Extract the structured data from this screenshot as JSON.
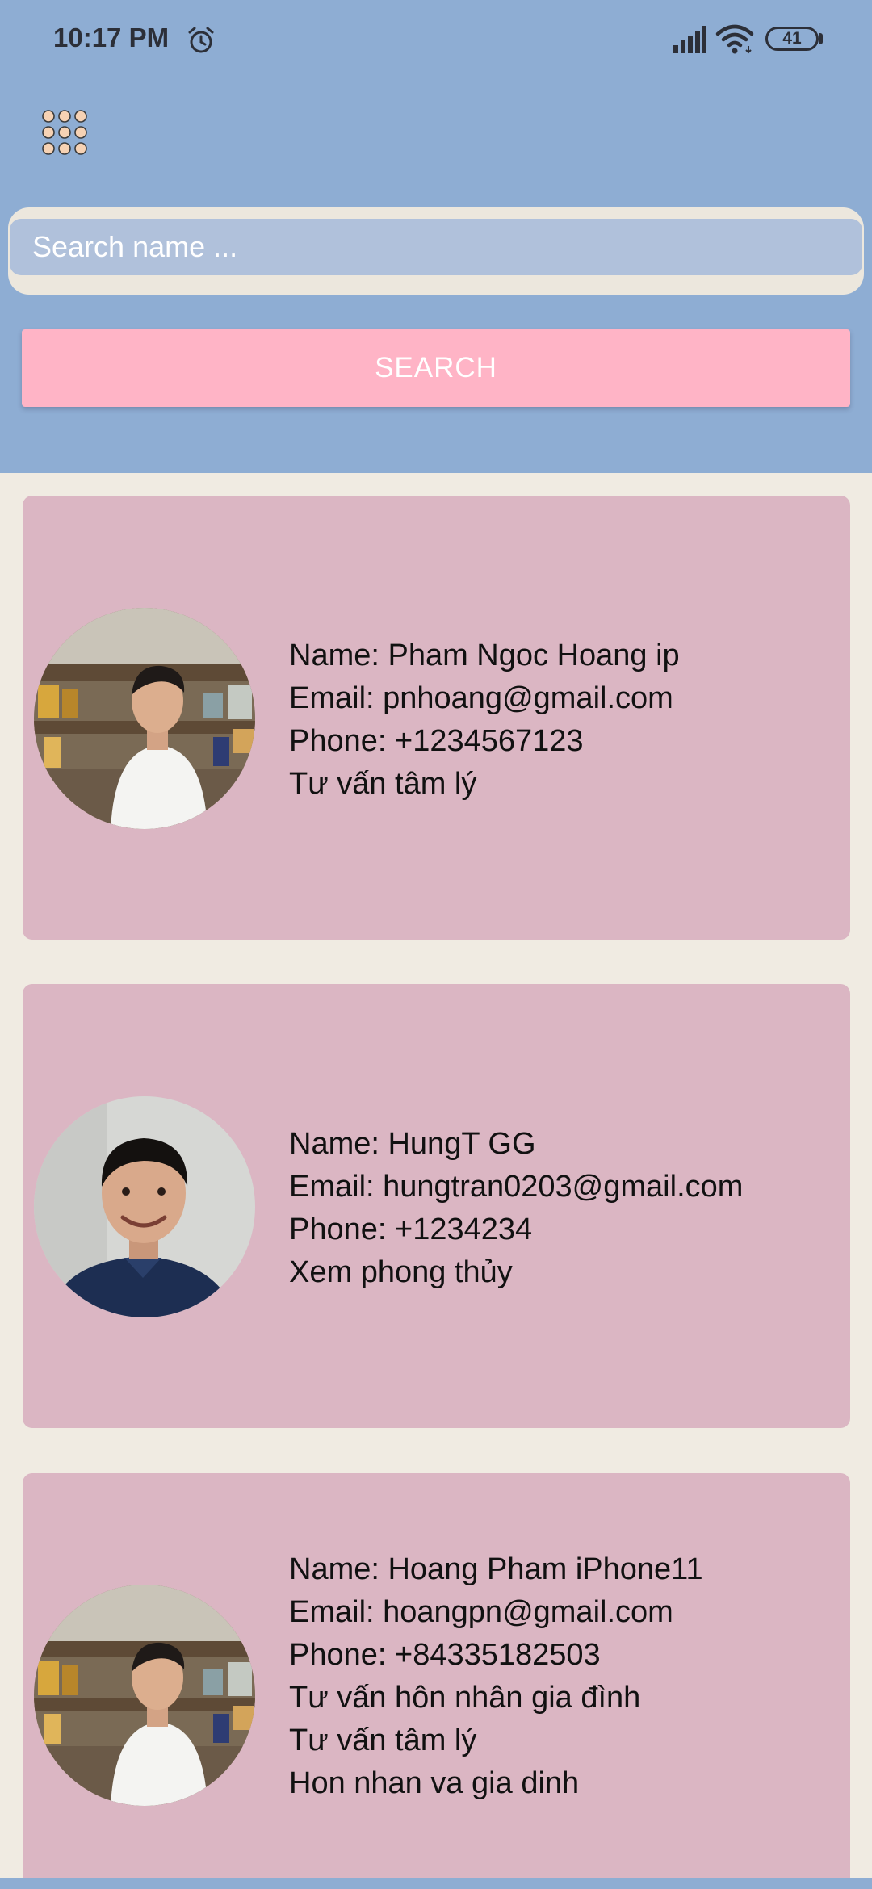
{
  "status_bar": {
    "time": "10:17 PM",
    "battery": "41",
    "icons": [
      "alarm-icon",
      "signal-icon",
      "wifi-icon",
      "battery-icon"
    ]
  },
  "toolbar": {
    "menu_icon": "apps-grid-icon"
  },
  "search": {
    "placeholder": "Search name ...",
    "value": "",
    "button_label": "SEARCH"
  },
  "contacts": [
    {
      "name": "Name: Pham Ngoc Hoang ip",
      "email": "Email: pnhoang@gmail.com",
      "phone": "Phone: +1234567123",
      "services": [
        "Tư vấn tâm lý"
      ]
    },
    {
      "name": "Name: HungT GG",
      "email": "Email: hungtran0203@gmail.com",
      "phone": "Phone: +1234234",
      "services": [
        "Xem phong thủy"
      ]
    },
    {
      "name": "Name: Hoang Pham iPhone11",
      "email": "Email: hoangpn@gmail.com",
      "phone": "Phone: +84335182503",
      "services": [
        "Tư vấn hôn nhân gia đình",
        "Tư vấn tâm lý",
        "Hon nhan va gia dinh"
      ]
    }
  ],
  "colors": {
    "header_bg": "#8eadd3",
    "page_bg": "#f0ebe2",
    "card_bg": "#dbb6c3",
    "search_field_bg": "#b0c1db",
    "search_button_bg": "#ffb4c6"
  }
}
